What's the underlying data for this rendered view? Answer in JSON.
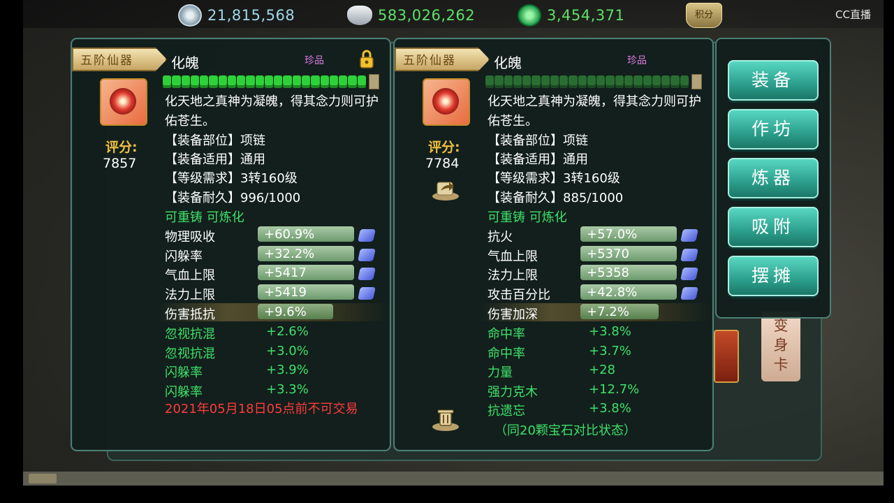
{
  "currency": [
    {
      "icon": "tribute-coin-icon",
      "value": "21,815,568",
      "color": "#9fd7ea"
    },
    {
      "icon": "silver-ingot-icon",
      "value": "583,026,262",
      "color": "#5fe06a"
    },
    {
      "icon": "jade-coin-icon",
      "value": "3,454,371",
      "color": "#5fe06a"
    }
  ],
  "cc_logo": "CC直播",
  "panels": [
    {
      "rank": "五阶仙器",
      "name": "化魄",
      "quality": "珍品",
      "durability_fill": 1.0,
      "desc": "化天地之真神为凝魄，得其念力则可护佑苍生。",
      "score_label": "评分:",
      "score": "7857",
      "info": [
        "【装备部位】项链",
        "【装备适用】通用",
        "【等级需求】3转160级",
        "【装备耐久】996/1000"
      ],
      "tags": "可重铸 可炼化",
      "bar_stats": [
        {
          "name": "物理吸收",
          "value": "+60.9%",
          "fill": 0.95
        },
        {
          "name": "闪躲率",
          "value": "+32.2%",
          "fill": 0.95
        },
        {
          "name": "气血上限",
          "value": "+5417",
          "fill": 0.95
        },
        {
          "name": "法力上限",
          "value": "+5419",
          "fill": 0.95
        }
      ],
      "special_stat": {
        "name": "伤害抵抗",
        "value": "+9.6%",
        "fill": 0.78
      },
      "plain_stats": [
        {
          "name": "忽视抗混",
          "value": "+2.6%"
        },
        {
          "name": "忽视抗混",
          "value": "+3.0%"
        },
        {
          "name": "闪躲率",
          "value": "+3.9%"
        },
        {
          "name": "闪躲率",
          "value": "+3.3%"
        }
      ],
      "trade_note": "2021年05月18日05点前不可交易",
      "footnote": ""
    },
    {
      "rank": "五阶仙器",
      "name": "化魄",
      "quality": "珍品",
      "durability_fill": 0.885,
      "desc": "化天地之真神为凝魄，得其念力则可护佑苍生。",
      "score_label": "评分:",
      "score": "7784",
      "info": [
        "【装备部位】项链",
        "【装备适用】通用",
        "【等级需求】3转160级",
        "【装备耐久】885/1000"
      ],
      "tags": "可重铸 可炼化",
      "bar_stats": [
        {
          "name": "抗火",
          "value": "+57.0%",
          "fill": 0.95
        },
        {
          "name": "气血上限",
          "value": "+5370",
          "fill": 0.95
        },
        {
          "name": "法力上限",
          "value": "+5358",
          "fill": 0.95
        },
        {
          "name": "攻击百分比",
          "value": "+42.8%",
          "fill": 0.95
        }
      ],
      "special_stat": {
        "name": "伤害加深",
        "value": "+7.2%",
        "fill": 0.82
      },
      "plain_stats": [
        {
          "name": "命中率",
          "value": "+3.8%"
        },
        {
          "name": "命中率",
          "value": "+3.7%"
        },
        {
          "name": "力量",
          "value": "+28"
        },
        {
          "name": "强力克木",
          "value": "+12.7%"
        },
        {
          "name": "抗遗忘",
          "value": "+3.8%"
        }
      ],
      "trade_note": "",
      "footnote": "（同20颗宝石对比状态）"
    }
  ],
  "menu": [
    "装备",
    "作坊",
    "炼器",
    "吸附",
    "摆摊"
  ],
  "transform_card": "变身卡",
  "top_button": "积分"
}
